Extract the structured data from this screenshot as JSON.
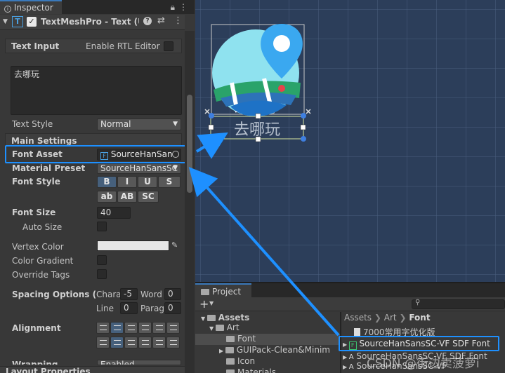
{
  "inspector": {
    "tab_label": "Inspector",
    "component_title": "TextMeshPro - Text (UI)",
    "text_input_label": "Text Input",
    "rtl_label": "Enable RTL Editor",
    "text_value": "去哪玩",
    "text_style_label": "Text Style",
    "text_style_value": "Normal",
    "main_settings_label": "Main Settings",
    "font_asset_label": "Font Asset",
    "font_asset_value": "SourceHanSan",
    "material_preset_label": "Material Preset",
    "material_preset_value": "SourceHanSansSC",
    "font_style_label": "Font Style",
    "font_style_buttons": [
      "B",
      "I",
      "U",
      "S"
    ],
    "font_style_buttons2": [
      "ab",
      "AB",
      "SC"
    ],
    "font_size_label": "Font Size",
    "font_size_value": "40",
    "auto_size_label": "Auto Size",
    "vertex_color_label": "Vertex Color",
    "color_gradient_label": "Color Gradient",
    "override_tags_label": "Override Tags",
    "spacing_label": "Spacing Options (em)",
    "chara_label": "Chara",
    "chara_value": "-5",
    "word_label": "Word",
    "word_value": "0",
    "line_label": "Line",
    "line_value": "0",
    "parag_label": "Parag",
    "parag_value": "0",
    "alignment_label": "Alignment",
    "wrapping_label": "Wrapping",
    "wrapping_value": "Enabled",
    "layout_label": "Layout Properties"
  },
  "scene": {
    "text_label": "去哪玩"
  },
  "project": {
    "tab_label": "Project",
    "add_label": "+",
    "tree": [
      "Assets",
      "Art",
      "Font",
      "GUIPack-Clean&Minim",
      "Icon",
      "Materials"
    ],
    "breadcrumb": [
      "Assets",
      "Art",
      "Font"
    ],
    "files": [
      "7000常用字优化版",
      "SourceHanSansSC-VF SDF Font",
      "SourceHanSansSC-VF"
    ],
    "watermark": "CSDN @街边卖菠萝i"
  },
  "colors": {
    "highlight": "#1e90ff",
    "scene_bg": "#2c3e5a",
    "accent": "#3a79bb"
  }
}
